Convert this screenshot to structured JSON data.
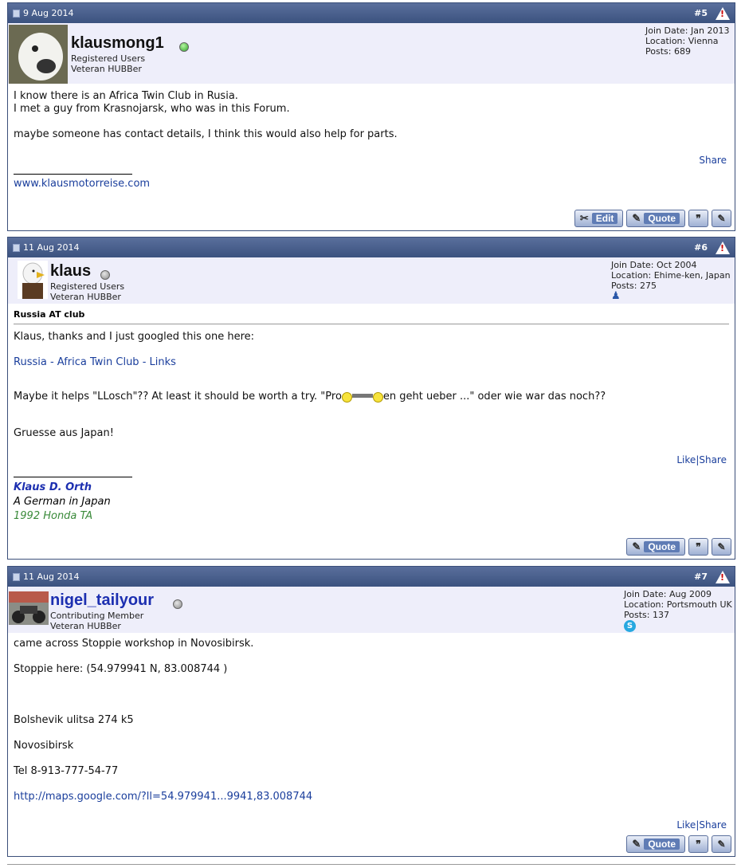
{
  "posts": [
    {
      "date": "9 Aug 2014",
      "number": "#5",
      "username": "klausmong1",
      "online": true,
      "user_titles": [
        "Registered Users",
        "Veteran HUBBer"
      ],
      "info": [
        "Join Date: Jan 2013",
        "Location: Vienna",
        "Posts: 689"
      ],
      "body": [
        "I know there is an Africa Twin Club in Rusia.",
        "I met a guy from Krasnojarsk, who was in this Forum.",
        "",
        "maybe someone has contact details, I think this would also help for parts."
      ],
      "share": "Share",
      "signature_link": "www.klausmotorreise.com",
      "buttons": {
        "edit": "Edit",
        "quote": "Quote"
      }
    },
    {
      "date": "11 Aug 2014",
      "number": "#6",
      "username": "klaus",
      "online": false,
      "user_titles": [
        "Registered Users",
        "Veteran HUBBer"
      ],
      "info": [
        "Join Date: Oct 2004",
        "Location: Ehime-ken, Japan",
        "Posts: 275"
      ],
      "topic_title": "Russia AT club",
      "body_intro": "Klaus, thanks and I just googled this one here:",
      "body_link": "Russia - Africa Twin Club - Links",
      "body_line_a": "Maybe it helps \"LLosch\"?? At least it should be worth a try. \"Pro",
      "body_line_b": "en geht ueber ...\" oder wie war das noch??",
      "body_outro": "Gruesse aus Japan!",
      "like": "Like",
      "share": "Share",
      "signature": [
        "Klaus D. Orth",
        "A German in Japan",
        "1992 Honda TA"
      ],
      "buttons": {
        "quote": "Quote"
      }
    },
    {
      "date": "11 Aug 2014",
      "number": "#7",
      "username": "nigel_tailyour",
      "online": false,
      "user_titles": [
        "Contributing Member",
        "Veteran HUBBer"
      ],
      "info": [
        "Join Date: Aug 2009",
        "Location: Portsmouth UK",
        "Posts: 137"
      ],
      "body_lines": [
        "came across Stoppie workshop in Novosibirsk.",
        "Stoppie here: (54.979941 N, 83.008744 )",
        "Bolshevik ulitsa 274 k5",
        "Novosibirsk",
        "Tel 8-913-777-54-77"
      ],
      "body_link": "http://maps.google.com/?ll=54.979941...9941,83.008744",
      "like": "Like",
      "share": "Share",
      "buttons": {
        "quote": "Quote"
      }
    }
  ],
  "colors": {
    "header_bg": "#3b527f",
    "userbar_bg": "#eeeefa",
    "link": "#1a3e9c",
    "username_blue": "#1c2fb0",
    "sig_green": "#3a8a3a"
  }
}
